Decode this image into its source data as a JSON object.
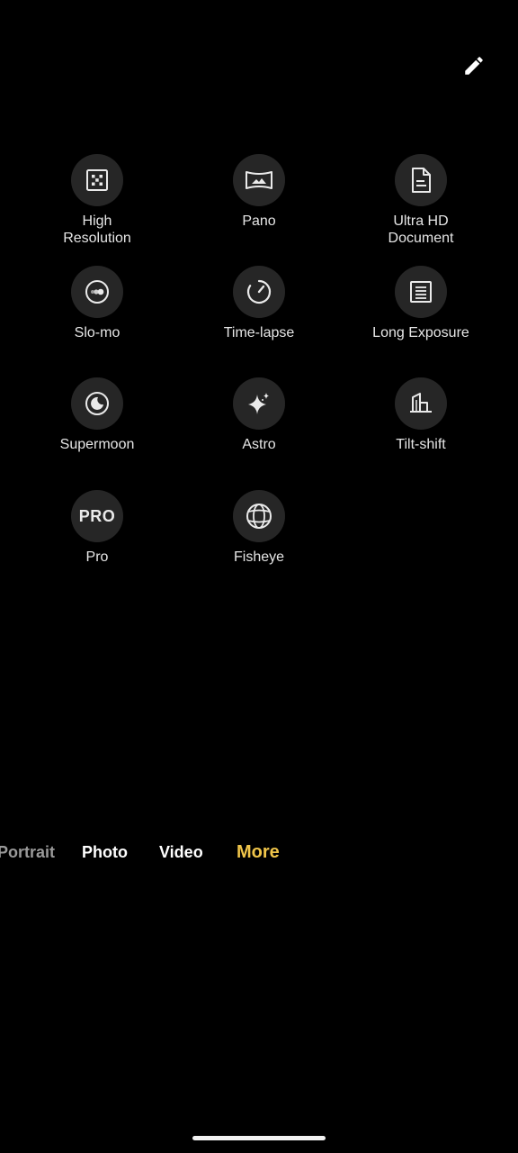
{
  "edit_icon": "pencil-icon",
  "modes": [
    {
      "name": "High\nResolution",
      "icon": "high-resolution-icon"
    },
    {
      "name": "Pano",
      "icon": "pano-icon"
    },
    {
      "name": "Ultra HD\nDocument",
      "icon": "document-icon"
    },
    {
      "name": "Slo-mo",
      "icon": "slo-mo-icon"
    },
    {
      "name": "Time-lapse",
      "icon": "time-lapse-icon"
    },
    {
      "name": "Long Exposure",
      "icon": "long-exposure-icon"
    },
    {
      "name": "Supermoon",
      "icon": "supermoon-icon"
    },
    {
      "name": "Astro",
      "icon": "astro-icon"
    },
    {
      "name": "Tilt-shift",
      "icon": "tilt-shift-icon"
    },
    {
      "name": "Pro",
      "icon": "pro-icon",
      "icon_text": "PRO"
    },
    {
      "name": "Fisheye",
      "icon": "fisheye-icon"
    }
  ],
  "camera_tabs": [
    {
      "label": "Portrait",
      "state": "faded"
    },
    {
      "label": "Photo",
      "state": "normal"
    },
    {
      "label": "Video",
      "state": "normal"
    },
    {
      "label": "More",
      "state": "active"
    }
  ],
  "colors": {
    "background": "#000000",
    "icon_circle": "#262626",
    "active_tab": "#f0c54a"
  }
}
